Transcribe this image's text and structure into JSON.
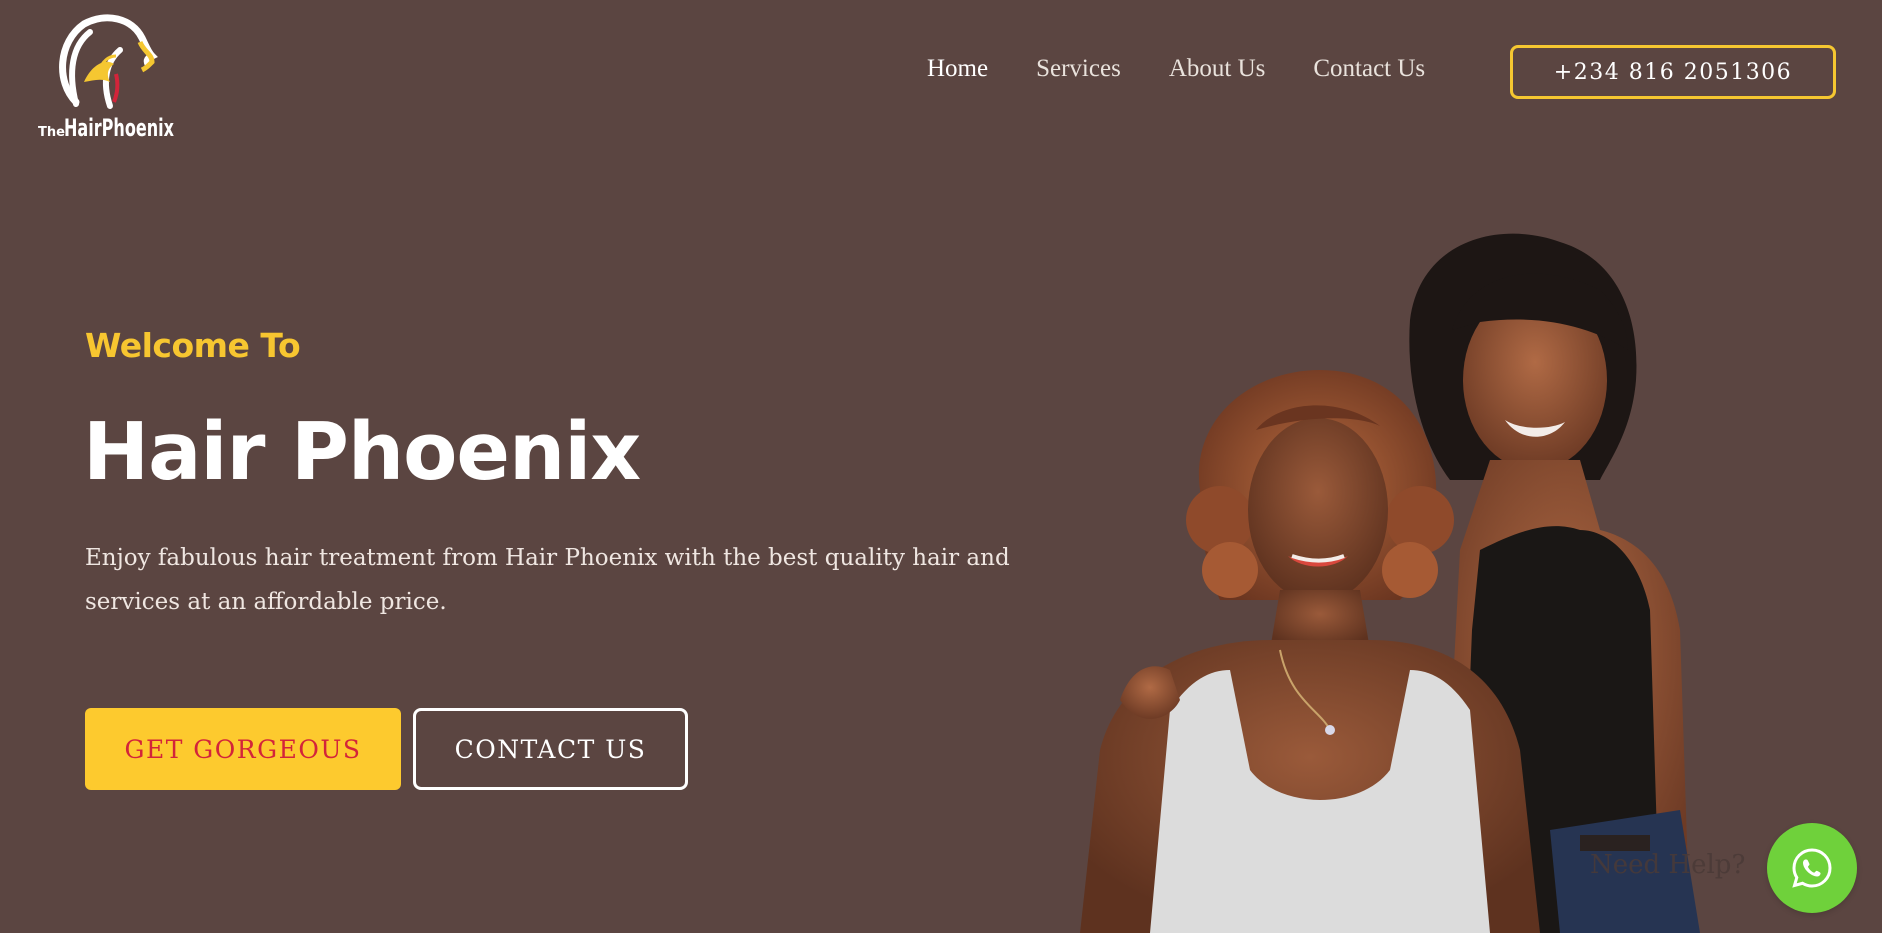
{
  "brand": {
    "logo_alt": "The Hair Phoenix",
    "logo_text_small": "The",
    "logo_text_large": "HairPhoenix"
  },
  "nav": {
    "items": [
      {
        "label": "Home",
        "active": true
      },
      {
        "label": "Services",
        "active": false
      },
      {
        "label": "About Us",
        "active": false
      },
      {
        "label": "Contact Us",
        "active": false
      }
    ],
    "phone": "+234 816 2051306"
  },
  "hero": {
    "welcome": "Welcome To",
    "title": "Hair Phoenix",
    "description": "Enjoy fabulous hair treatment from Hair Phoenix with the best quality hair and services at an affordable price.",
    "primary_cta": "GET GORGEOUS",
    "secondary_cta": "CONTACT US"
  },
  "widget": {
    "help_text": "Need Help?",
    "icon": "whatsapp-icon"
  },
  "colors": {
    "background": "#5b4541",
    "accent_yellow": "#fdca2e",
    "cta_text_red": "#d3243a",
    "whatsapp_green": "#6fd13b"
  }
}
